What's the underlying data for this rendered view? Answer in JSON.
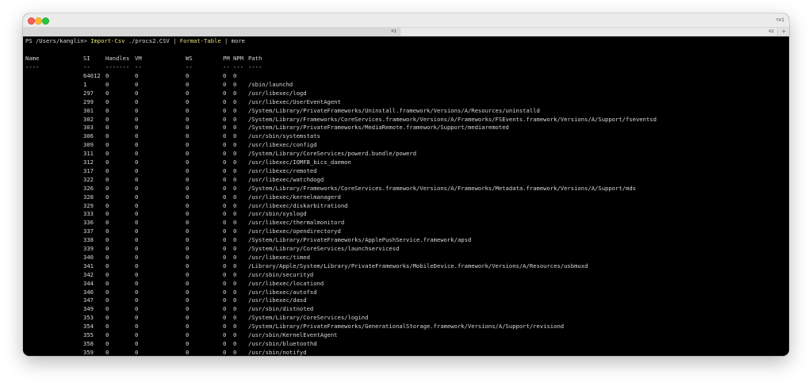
{
  "window": {
    "new_window_shortcut": "⌥⌘1",
    "tabs": [
      {
        "shortcut": "⌘1"
      },
      {
        "shortcut": "⌘2"
      }
    ],
    "new_tab_symbol": "+"
  },
  "terminal": {
    "prompt": "PS /Users/kanglin>",
    "command_part1": "Import-Csv",
    "command_part2": "./procs2.CSV |",
    "command_part3": "Format-Table",
    "command_part4": "| more",
    "headers": {
      "name": "Name",
      "si": "SI",
      "handles": "Handles",
      "vm": "VM",
      "ws": "WS",
      "pm": "PM",
      "npm": "NPM",
      "path": "Path"
    },
    "separators": {
      "name": "----",
      "si": "--",
      "handles": "-------",
      "vm": "--",
      "ws": "--",
      "pm": "--",
      "npm": "---",
      "path": "----"
    },
    "rows": [
      {
        "si": "64012",
        "handles": "0",
        "vm": "0",
        "ws": "0",
        "pm": "0",
        "npm": "0",
        "path": ""
      },
      {
        "si": "1",
        "handles": "0",
        "vm": "0",
        "ws": "0",
        "pm": "0",
        "npm": "0",
        "path": "/sbin/launchd"
      },
      {
        "si": "297",
        "handles": "0",
        "vm": "0",
        "ws": "0",
        "pm": "0",
        "npm": "0",
        "path": "/usr/libexec/logd"
      },
      {
        "si": "299",
        "handles": "0",
        "vm": "0",
        "ws": "0",
        "pm": "0",
        "npm": "0",
        "path": "/usr/libexec/UserEventAgent"
      },
      {
        "si": "301",
        "handles": "0",
        "vm": "0",
        "ws": "0",
        "pm": "0",
        "npm": "0",
        "path": "/System/Library/PrivateFrameworks/Uninstall.framework/Versions/A/Resources/uninstalld"
      },
      {
        "si": "302",
        "handles": "0",
        "vm": "0",
        "ws": "0",
        "pm": "0",
        "npm": "0",
        "path": "/System/Library/Frameworks/CoreServices.framework/Versions/A/Frameworks/FSEvents.framework/Versions/A/Support/fseventsd"
      },
      {
        "si": "303",
        "handles": "0",
        "vm": "0",
        "ws": "0",
        "pm": "0",
        "npm": "0",
        "path": "/System/Library/PrivateFrameworks/MediaRemote.framework/Support/mediaremoted"
      },
      {
        "si": "306",
        "handles": "0",
        "vm": "0",
        "ws": "0",
        "pm": "0",
        "npm": "0",
        "path": "/usr/sbin/systemstats"
      },
      {
        "si": "309",
        "handles": "0",
        "vm": "0",
        "ws": "0",
        "pm": "0",
        "npm": "0",
        "path": "/usr/libexec/configd"
      },
      {
        "si": "311",
        "handles": "0",
        "vm": "0",
        "ws": "0",
        "pm": "0",
        "npm": "0",
        "path": "/System/Library/CoreServices/powerd.bundle/powerd"
      },
      {
        "si": "312",
        "handles": "0",
        "vm": "0",
        "ws": "0",
        "pm": "0",
        "npm": "0",
        "path": "/usr/libexec/IOMFB_bics_daemon"
      },
      {
        "si": "317",
        "handles": "0",
        "vm": "0",
        "ws": "0",
        "pm": "0",
        "npm": "0",
        "path": "/usr/libexec/remoted"
      },
      {
        "si": "322",
        "handles": "0",
        "vm": "0",
        "ws": "0",
        "pm": "0",
        "npm": "0",
        "path": "/usr/libexec/watchdogd"
      },
      {
        "si": "326",
        "handles": "0",
        "vm": "0",
        "ws": "0",
        "pm": "0",
        "npm": "0",
        "path": "/System/Library/Frameworks/CoreServices.framework/Versions/A/Frameworks/Metadata.framework/Versions/A/Support/mds"
      },
      {
        "si": "328",
        "handles": "0",
        "vm": "0",
        "ws": "0",
        "pm": "0",
        "npm": "0",
        "path": "/usr/libexec/kernelmanagerd"
      },
      {
        "si": "329",
        "handles": "0",
        "vm": "0",
        "ws": "0",
        "pm": "0",
        "npm": "0",
        "path": "/usr/libexec/diskarbitrationd"
      },
      {
        "si": "333",
        "handles": "0",
        "vm": "0",
        "ws": "0",
        "pm": "0",
        "npm": "0",
        "path": "/usr/sbin/syslogd"
      },
      {
        "si": "336",
        "handles": "0",
        "vm": "0",
        "ws": "0",
        "pm": "0",
        "npm": "0",
        "path": "/usr/libexec/thermalmonitord"
      },
      {
        "si": "337",
        "handles": "0",
        "vm": "0",
        "ws": "0",
        "pm": "0",
        "npm": "0",
        "path": "/usr/libexec/opendirectoryd"
      },
      {
        "si": "338",
        "handles": "0",
        "vm": "0",
        "ws": "0",
        "pm": "0",
        "npm": "0",
        "path": "/System/Library/PrivateFrameworks/ApplePushService.framework/apsd"
      },
      {
        "si": "339",
        "handles": "0",
        "vm": "0",
        "ws": "0",
        "pm": "0",
        "npm": "0",
        "path": "/System/Library/CoreServices/launchservicesd"
      },
      {
        "si": "340",
        "handles": "0",
        "vm": "0",
        "ws": "0",
        "pm": "0",
        "npm": "0",
        "path": "/usr/libexec/timed"
      },
      {
        "si": "341",
        "handles": "0",
        "vm": "0",
        "ws": "0",
        "pm": "0",
        "npm": "0",
        "path": "/Library/Apple/System/Library/PrivateFrameworks/MobileDevice.framework/Versions/A/Resources/usbmuxd"
      },
      {
        "si": "342",
        "handles": "0",
        "vm": "0",
        "ws": "0",
        "pm": "0",
        "npm": "0",
        "path": "/usr/sbin/securityd"
      },
      {
        "si": "344",
        "handles": "0",
        "vm": "0",
        "ws": "0",
        "pm": "0",
        "npm": "0",
        "path": "/usr/libexec/locationd"
      },
      {
        "si": "346",
        "handles": "0",
        "vm": "0",
        "ws": "0",
        "pm": "0",
        "npm": "0",
        "path": "/usr/libexec/autofsd"
      },
      {
        "si": "347",
        "handles": "0",
        "vm": "0",
        "ws": "0",
        "pm": "0",
        "npm": "0",
        "path": "/usr/libexec/dasd"
      },
      {
        "si": "349",
        "handles": "0",
        "vm": "0",
        "ws": "0",
        "pm": "0",
        "npm": "0",
        "path": "/usr/sbin/distnoted"
      },
      {
        "si": "353",
        "handles": "0",
        "vm": "0",
        "ws": "0",
        "pm": "0",
        "npm": "0",
        "path": "/System/Library/CoreServices/logind"
      },
      {
        "si": "354",
        "handles": "0",
        "vm": "0",
        "ws": "0",
        "pm": "0",
        "npm": "0",
        "path": "/System/Library/PrivateFrameworks/GenerationalStorage.framework/Versions/A/Support/revisiond"
      },
      {
        "si": "355",
        "handles": "0",
        "vm": "0",
        "ws": "0",
        "pm": "0",
        "npm": "0",
        "path": "/usr/sbin/KernelEventAgent"
      },
      {
        "si": "358",
        "handles": "0",
        "vm": "0",
        "ws": "0",
        "pm": "0",
        "npm": "0",
        "path": "/usr/sbin/bluetoothd"
      },
      {
        "si": "359",
        "handles": "0",
        "vm": "0",
        "ws": "0",
        "pm": "0",
        "npm": "0",
        "path": "/usr/sbin/notifyd"
      }
    ]
  }
}
